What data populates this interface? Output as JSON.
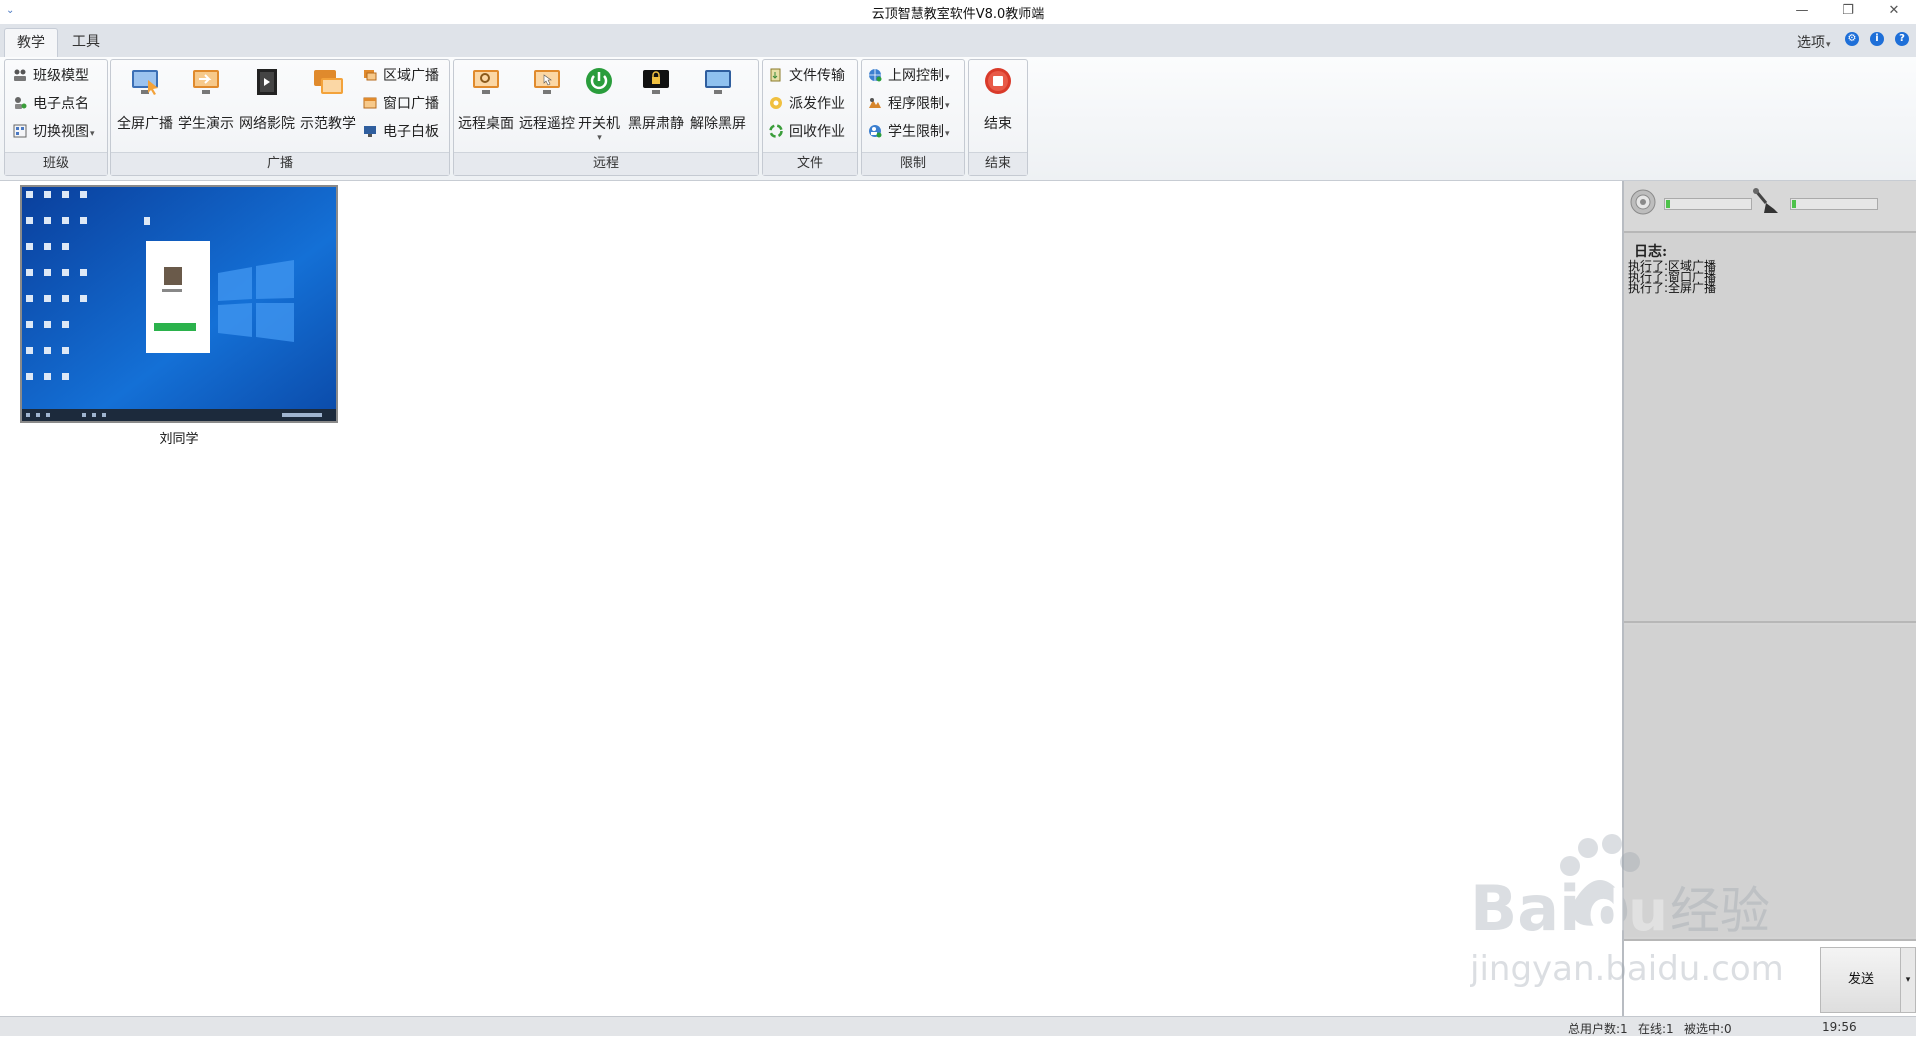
{
  "window": {
    "title": "云顶智慧教室软件V8.0教师端",
    "minimize_glyph": "—",
    "restore_glyph": "❐",
    "close_glyph": "✕"
  },
  "tabs": [
    {
      "label": "教学",
      "active": true
    },
    {
      "label": "工具",
      "active": false
    }
  ],
  "options": {
    "label": "选项"
  },
  "ribbon": {
    "class_group": {
      "label": "班级",
      "items": [
        {
          "label": "班级模型"
        },
        {
          "label": "电子点名"
        },
        {
          "label": "切换视图"
        }
      ]
    },
    "broadcast_group": {
      "label": "广播",
      "big_items": [
        {
          "label": "全屏广播"
        },
        {
          "label": "学生演示"
        },
        {
          "label": "网络影院"
        },
        {
          "label": "示范教学"
        }
      ],
      "small_items": [
        {
          "label": "区域广播"
        },
        {
          "label": "窗口广播"
        },
        {
          "label": "电子白板"
        }
      ]
    },
    "remote_group": {
      "label": "远程",
      "items": [
        {
          "label": "远程桌面"
        },
        {
          "label": "远程遥控"
        },
        {
          "label": "开关机"
        },
        {
          "label": "黑屏肃静"
        },
        {
          "label": "解除黑屏"
        }
      ]
    },
    "file_group": {
      "label": "文件",
      "items": [
        {
          "label": "文件传输"
        },
        {
          "label": "派发作业"
        },
        {
          "label": "回收作业"
        }
      ]
    },
    "limit_group": {
      "label": "限制",
      "items": [
        {
          "label": "上网控制"
        },
        {
          "label": "程序限制"
        },
        {
          "label": "学生限制"
        }
      ]
    },
    "end_group": {
      "label": "结束",
      "item": {
        "label": "结束"
      }
    }
  },
  "students": [
    {
      "name": "刘同学",
      "online": true
    }
  ],
  "audio": {
    "volume_level": 0.05,
    "mic_level": 0.05
  },
  "log": {
    "title": "日志:",
    "entries": [
      "执行了:区域广播",
      "执行了:窗口广播",
      "执行了:全屏广播"
    ]
  },
  "send": {
    "label": "发送"
  },
  "status": {
    "total_users": "总用户数:1",
    "online": "在线:1",
    "selected": "被选中:0",
    "time": "19:56"
  },
  "watermark": {
    "text": "Baidu经验",
    "url_text": "jingyan.baidu.com"
  },
  "colors": {
    "accent": "#1e6fd8",
    "ribbon_bg": "#eef1f4",
    "panel_bg": "#d4d4d4"
  }
}
